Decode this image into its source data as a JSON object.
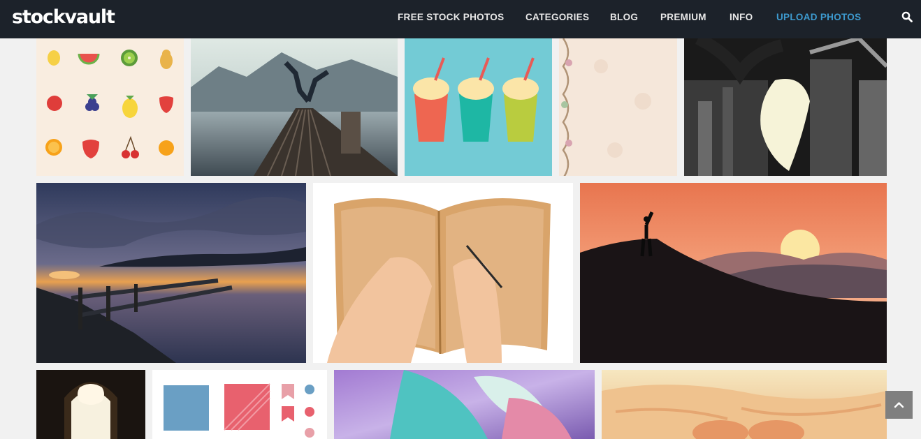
{
  "brand": {
    "logo": "stockvault"
  },
  "nav": {
    "items": [
      {
        "label": "FREE STOCK PHOTOS"
      },
      {
        "label": "CATEGORIES"
      },
      {
        "label": "BLOG"
      },
      {
        "label": "PREMIUM"
      },
      {
        "label": "INFO"
      },
      {
        "label": "UPLOAD PHOTOS"
      }
    ],
    "search_icon": "search-icon"
  },
  "colors": {
    "topbar": "#1c222a",
    "accent": "#3d9bd0",
    "page_bg": "#f1f1f1"
  },
  "gallery": {
    "row1": [
      {
        "subject": "fruit icons pattern"
      },
      {
        "subject": "man on wooden pier over lake"
      },
      {
        "subject": "three milkshakes illustration"
      },
      {
        "subject": "floral vintage paper"
      },
      {
        "subject": "double exposure couple city"
      }
    ],
    "row2": [
      {
        "subject": "sunset over lake with broken pier"
      },
      {
        "subject": "hands writing in old book"
      },
      {
        "subject": "silhouette on mountain at sunset"
      }
    ],
    "row3": [
      {
        "subject": "gothic window"
      },
      {
        "subject": "scrapbook elements"
      },
      {
        "subject": "colorful leaves macro"
      },
      {
        "subject": "sunglasses on sand"
      }
    ]
  },
  "back_to_top_icon": "chevron-up-icon"
}
